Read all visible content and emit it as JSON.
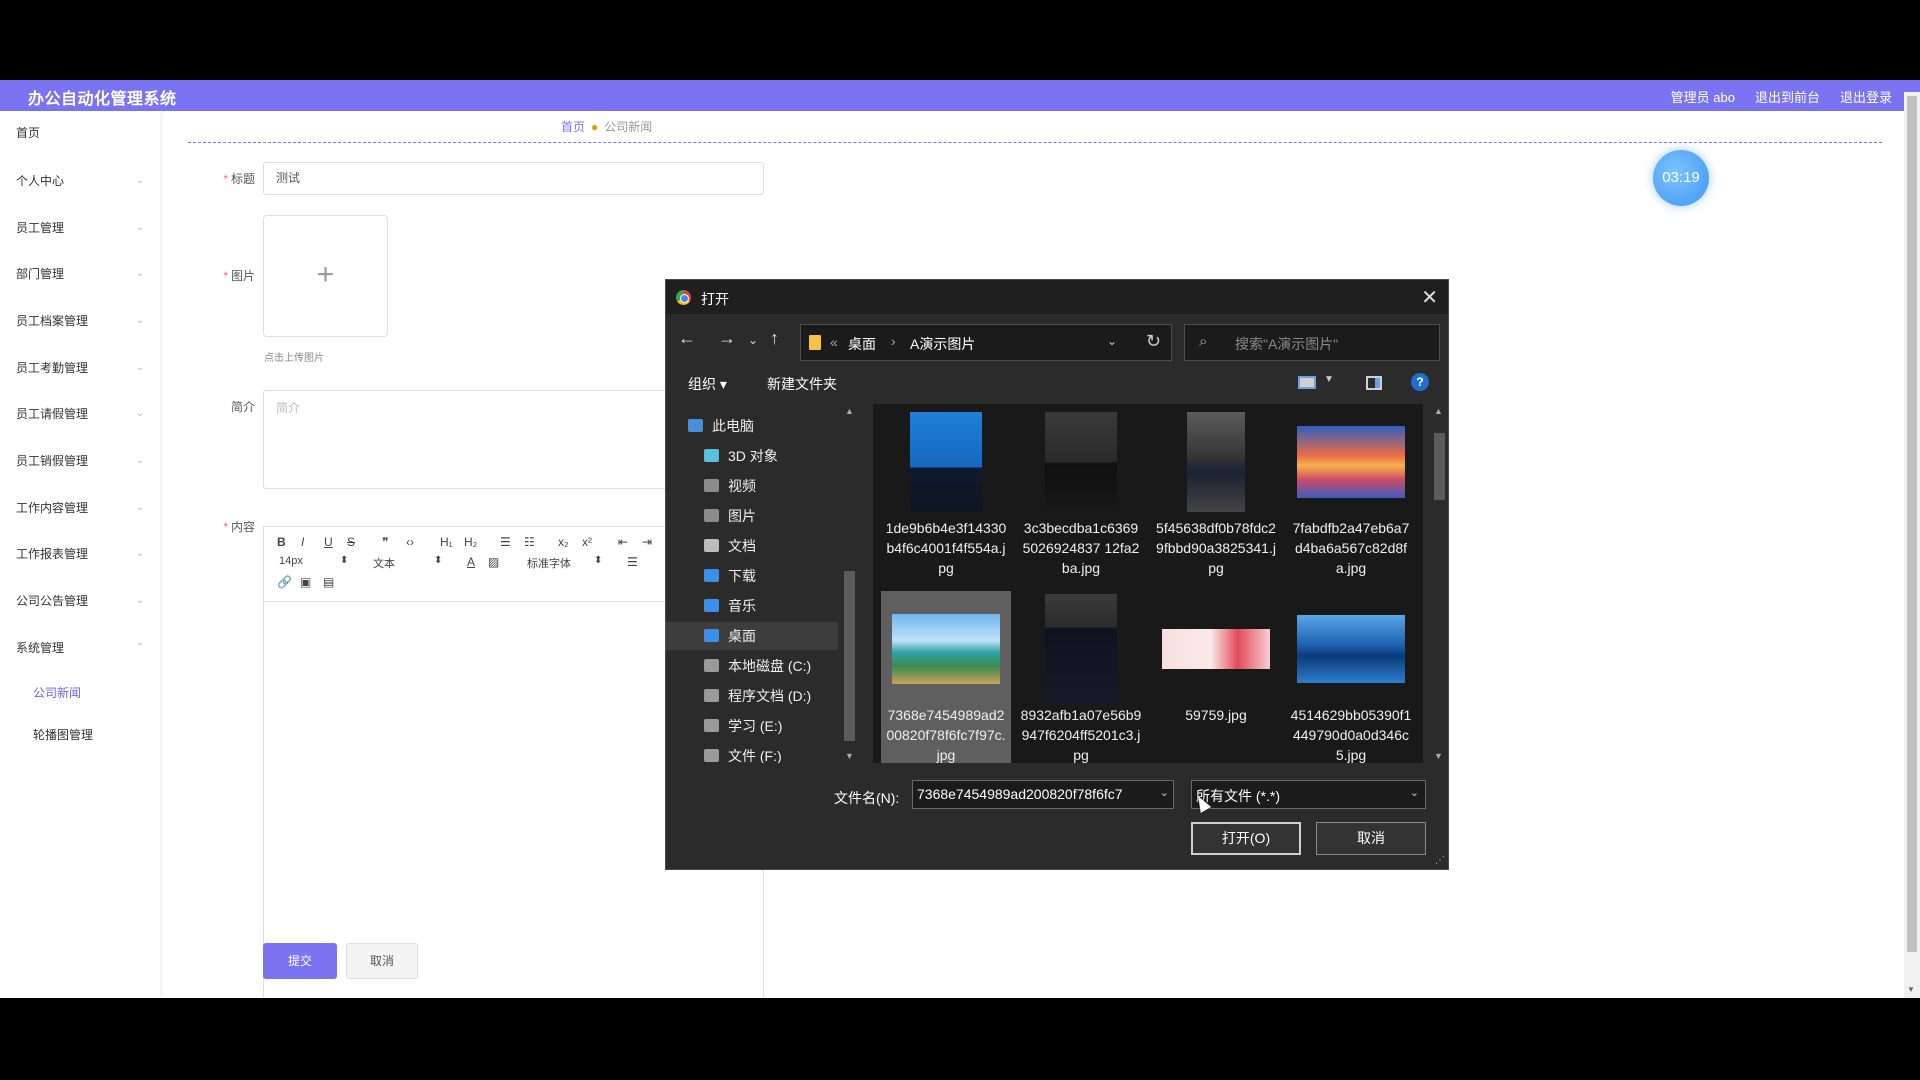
{
  "app": {
    "title": "办公自动化管理系统",
    "header_links": [
      "管理员 abo",
      "退出到前台",
      "退出登录"
    ]
  },
  "sidebar": {
    "items": [
      {
        "label": "首页",
        "chevron": false
      },
      {
        "label": "个人中心",
        "chevron": true
      },
      {
        "label": "员工管理",
        "chevron": true
      },
      {
        "label": "部门管理",
        "chevron": true
      },
      {
        "label": "员工档案管理",
        "chevron": true
      },
      {
        "label": "员工考勤管理",
        "chevron": true
      },
      {
        "label": "员工请假管理",
        "chevron": true
      },
      {
        "label": "员工销假管理",
        "chevron": true
      },
      {
        "label": "工作内容管理",
        "chevron": true
      },
      {
        "label": "工作报表管理",
        "chevron": true
      },
      {
        "label": "公司公告管理",
        "chevron": true
      },
      {
        "label": "系统管理",
        "chevron": true
      }
    ],
    "subitems": [
      {
        "label": "公司新闻",
        "active": true
      },
      {
        "label": "轮播图管理",
        "active": false
      }
    ]
  },
  "breadcrumb": {
    "home": "首页",
    "current": "公司新闻"
  },
  "form": {
    "title_label": "标题",
    "title_value": "测试",
    "image_label": "图片",
    "upload_hint": "点击上传图片",
    "intro_label": "简介",
    "intro_placeholder": "简介",
    "content_label": "内容",
    "submit": "提交",
    "cancel": "取消"
  },
  "editor_toolbar": {
    "row1": [
      "B",
      "I",
      "U",
      "S",
      "❞",
      "‹›",
      "H₁",
      "H₂",
      "☰",
      "☷",
      "x₂",
      "x²",
      "⇤",
      "⇥"
    ],
    "font_size": "14px",
    "paragraph": "文本",
    "font_family": "标准字体"
  },
  "timer": "03:19",
  "dialog": {
    "title": "打开",
    "path": [
      "桌面",
      "A演示图片"
    ],
    "search_placeholder": "搜索\"A演示图片\"",
    "organize": "组织",
    "new_folder": "新建文件夹",
    "nav_items": [
      {
        "label": "此电脑",
        "icon": "computer-icon",
        "color": "#4a90d9"
      },
      {
        "label": "3D 对象",
        "icon": "cube-icon",
        "color": "#5bc0de"
      },
      {
        "label": "视频",
        "icon": "video-icon",
        "color": "#8b8b8b"
      },
      {
        "label": "图片",
        "icon": "picture-icon",
        "color": "#8b8b8b"
      },
      {
        "label": "文档",
        "icon": "document-icon",
        "color": "#bdbdbd"
      },
      {
        "label": "下载",
        "icon": "download-icon",
        "color": "#3b8fe8"
      },
      {
        "label": "音乐",
        "icon": "music-icon",
        "color": "#3b8fe8"
      },
      {
        "label": "桌面",
        "icon": "desktop-icon",
        "color": "#3b8fe8"
      },
      {
        "label": "本地磁盘 (C:)",
        "icon": "drive-icon",
        "color": "#9a9a9a"
      },
      {
        "label": "程序文档 (D:)",
        "icon": "drive-icon",
        "color": "#9a9a9a"
      },
      {
        "label": "学习 (E:)",
        "icon": "drive-icon",
        "color": "#9a9a9a"
      },
      {
        "label": "文件 (F:)",
        "icon": "drive-icon",
        "color": "#9a9a9a"
      }
    ],
    "selected_nav": "桌面",
    "files": [
      {
        "name": "1de9b6b4e3f14330b4f6c4001f4f554a.jpg",
        "kind": "portrait-blue",
        "selected": false
      },
      {
        "name": "3c3becdba1c63695026924837 12fa2ba.jpg",
        "kind": "portrait-dark",
        "selected": false
      },
      {
        "name": "5f45638df0b78fdc29fbbd90a3825341.jpg",
        "kind": "portrait-sitting",
        "selected": false
      },
      {
        "name": "7fabdfb2a47eb6a7d4ba6a567c82d8fa.jpg",
        "kind": "sunset",
        "selected": false
      },
      {
        "name": "7368e7454989ad200820f78f6fc7f97c.jpg",
        "kind": "beach",
        "selected": true
      },
      {
        "name": "8932afb1a07e56b9947f6204ff5201c3.jpg",
        "kind": "portrait-standing",
        "selected": false
      },
      {
        "name": "59759.jpg",
        "kind": "pink",
        "selected": false
      },
      {
        "name": "4514629bb05390f1449790d0a0d346c5.jpg",
        "kind": "lake",
        "selected": false
      }
    ],
    "filename_label": "文件名(N):",
    "filename_value": "7368e7454989ad200820f78f6fc7",
    "filter": "所有文件 (*.*)",
    "open": "打开(O)",
    "cancel": "取消"
  }
}
